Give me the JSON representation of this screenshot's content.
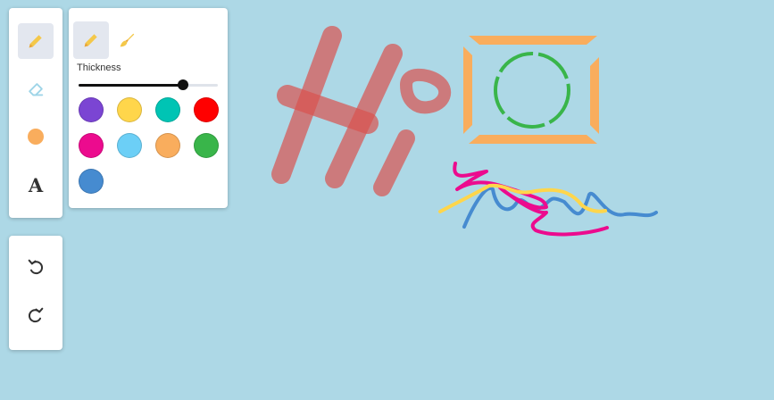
{
  "toolbar": {
    "tools": [
      {
        "name": "pencil-icon",
        "active": true
      },
      {
        "name": "eraser-icon",
        "active": false
      },
      {
        "name": "color-dot-icon",
        "active": false,
        "color": "#f9ad5d"
      },
      {
        "name": "text-tool-icon",
        "active": false,
        "glyph": "A"
      }
    ]
  },
  "history": {
    "undo_icon": "undo-icon",
    "redo_icon": "redo-icon"
  },
  "options": {
    "brush_modes": [
      {
        "name": "pencil-icon",
        "active": true
      },
      {
        "name": "brush-icon",
        "active": false
      }
    ],
    "thickness_label": "Thickness",
    "thickness_fraction": 0.75,
    "palette": [
      "#7b45d3",
      "#ffd64b",
      "#00c4b4",
      "#ff0000",
      "#ec0b8e",
      "#6ccff6",
      "#f9ad5d",
      "#39b54a",
      "#468bd0"
    ],
    "selected_color": "#f9ad5d"
  },
  "colors": {
    "canvas": "#add8e6",
    "accent": "#f4c84a",
    "stroke_red": "#d9534f",
    "stroke_orange": "#f9ad5d",
    "stroke_green": "#39b54a",
    "stroke_pink": "#ec0b8e",
    "stroke_yellow": "#ffd64b",
    "stroke_blue": "#468bd0"
  }
}
